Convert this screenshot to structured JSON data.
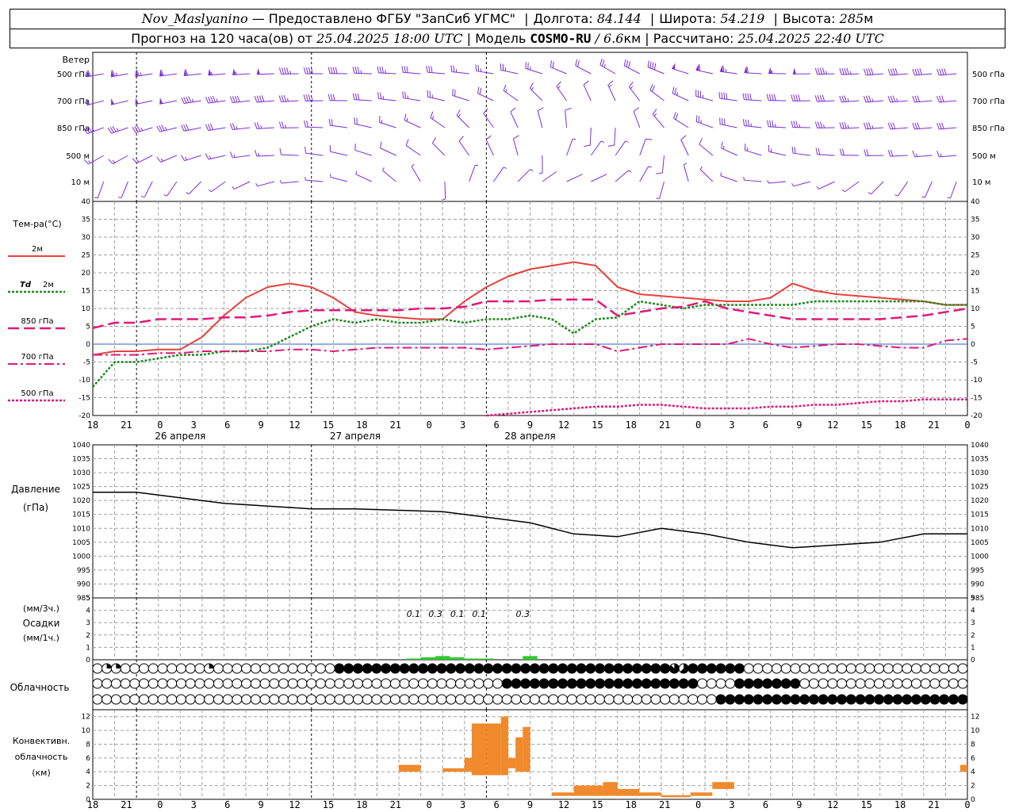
{
  "header": {
    "station": "Nov_Maslyanino",
    "provider": "— Предоставлено ФГБУ \"ЗапСиб УГМС\"",
    "lon_label": "Долгота:",
    "lon_value": "84.144",
    "lat_label": "Широта:",
    "lat_value": "54.219",
    "alt_label": "Высота:",
    "alt_value": "285",
    "alt_unit": "м",
    "forecast_prefix": "Прогноз на 120 часа(ов) от",
    "forecast_start": "25.04.2025 18:00 UTC",
    "model_label": "| Модель",
    "model_name": "COSMO-RU",
    "model_res": "/ 6.6",
    "model_res_unit": "км",
    "calc_label": "| Рассчитано:",
    "calc_time": "25.04.2025 22:40 UTC"
  },
  "colors": {
    "wind": "#7b2ed6",
    "t2m": "#e8413c",
    "td2m": "#1f8a1f",
    "t850": "#e0187a",
    "t700": "#e0187a",
    "t500": "#e0187a",
    "pressure": "#000000",
    "precip": "#32c832",
    "convective": "#f08a2c",
    "grid": "#a0a0a0"
  },
  "time_axis": {
    "ticks": [
      "18",
      "21",
      "0",
      "3",
      "6",
      "9",
      "12",
      "15",
      "18",
      "21",
      "0",
      "3",
      "6",
      "9",
      "12",
      "15",
      "18",
      "21",
      "0",
      "3",
      "6",
      "9",
      "12",
      "15",
      "18",
      "21",
      "0"
    ],
    "day_labels": [
      {
        "label": "26 апреля",
        "at": 12
      },
      {
        "label": "27 апреля",
        "at": 36
      },
      {
        "label": "28 апреля",
        "at": 60
      }
    ],
    "midnights": [
      6,
      30,
      54
    ]
  },
  "wind_panel": {
    "title": "Ветер",
    "levels": [
      "500 гПа",
      "700 гПа",
      "850 гПа",
      "500 м",
      "10 м"
    ],
    "speed_kt": [
      [
        60,
        62,
        64,
        62,
        60,
        58,
        55,
        52,
        48,
        44,
        40,
        36,
        34,
        32,
        30,
        28,
        26,
        26,
        24,
        22,
        20,
        22,
        28,
        36,
        48,
        56,
        62,
        64,
        60,
        55,
        48,
        44,
        42,
        40,
        40,
        40,
        38
      ],
      [
        48,
        50,
        52,
        50,
        48,
        45,
        42,
        40,
        38,
        35,
        32,
        30,
        28,
        26,
        24,
        22,
        20,
        18,
        16,
        14,
        12,
        12,
        14,
        18,
        24,
        30,
        36,
        40,
        42,
        42,
        40,
        38,
        36,
        34,
        32,
        30,
        30
      ],
      [
        32,
        34,
        36,
        35,
        33,
        30,
        28,
        26,
        24,
        22,
        20,
        18,
        18,
        16,
        15,
        14,
        12,
        12,
        10,
        10,
        8,
        8,
        10,
        12,
        16,
        22,
        28,
        32,
        34,
        36,
        36,
        36,
        34,
        32,
        30,
        28,
        28
      ],
      [
        15,
        16,
        16,
        15,
        14,
        14,
        13,
        13,
        12,
        12,
        11,
        11,
        10,
        10,
        9,
        9,
        8,
        8,
        7,
        6,
        6,
        6,
        7,
        8,
        9,
        10,
        12,
        14,
        16,
        18,
        20,
        22,
        22,
        20,
        18,
        16,
        14
      ],
      [
        4,
        4,
        5,
        5,
        6,
        6,
        6,
        5,
        5,
        4,
        4,
        4,
        4,
        3,
        3,
        3,
        3,
        3,
        3,
        2,
        2,
        2,
        3,
        3,
        3,
        4,
        4,
        5,
        5,
        5,
        5,
        5,
        5,
        4,
        4,
        4,
        4
      ]
    ],
    "dir_deg": [
      [
        260,
        260,
        260,
        262,
        262,
        265,
        265,
        268,
        268,
        270,
        270,
        272,
        272,
        274,
        275,
        275,
        278,
        280,
        285,
        290,
        295,
        300,
        300,
        295,
        290,
        285,
        280,
        275,
        272,
        270,
        268,
        268,
        266,
        265,
        265,
        265,
        265
      ],
      [
        255,
        255,
        258,
        258,
        260,
        262,
        262,
        265,
        265,
        268,
        270,
        272,
        275,
        278,
        280,
        285,
        290,
        300,
        310,
        320,
        330,
        340,
        330,
        315,
        300,
        290,
        280,
        275,
        272,
        270,
        268,
        266,
        265,
        265,
        265,
        265,
        265
      ],
      [
        250,
        250,
        252,
        255,
        258,
        260,
        262,
        265,
        268,
        270,
        275,
        280,
        285,
        290,
        300,
        310,
        320,
        330,
        340,
        350,
        360,
        10,
        350,
        330,
        310,
        295,
        285,
        278,
        275,
        272,
        270,
        268,
        266,
        265,
        265,
        265,
        265
      ],
      [
        240,
        240,
        242,
        245,
        250,
        255,
        260,
        265,
        270,
        275,
        280,
        285,
        290,
        300,
        310,
        320,
        330,
        340,
        350,
        10,
        30,
        40,
        30,
        10,
        350,
        320,
        300,
        290,
        285,
        280,
        275,
        272,
        270,
        268,
        266,
        265,
        265
      ],
      [
        200,
        200,
        205,
        210,
        220,
        230,
        240,
        250,
        260,
        270,
        280,
        290,
        300,
        320,
        340,
        10,
        30,
        40,
        50,
        60,
        70,
        60,
        40,
        20,
        360,
        330,
        300,
        280,
        270,
        260,
        250,
        240,
        230,
        220,
        210,
        200,
        200
      ]
    ]
  },
  "temp_panel": {
    "title": "Тем-ра(°C)",
    "legend": [
      {
        "key": "t2m",
        "label": "2м"
      },
      {
        "key": "td2m",
        "label_a": "Td",
        "label_b": "2м"
      },
      {
        "key": "t850",
        "label": "850 гПа"
      },
      {
        "key": "t700",
        "label": "700 гПа"
      },
      {
        "key": "t500",
        "label": "500 гПа"
      }
    ],
    "ylim": [
      -20,
      40
    ],
    "yticks": [
      -20,
      -15,
      -10,
      -5,
      0,
      5,
      10,
      15,
      20,
      25,
      30,
      35,
      40
    ]
  },
  "pressure_panel": {
    "title": "Давление",
    "unit": "(гПа)",
    "ylim": [
      985,
      1040
    ],
    "yticks": [
      985,
      990,
      995,
      1000,
      1005,
      1010,
      1015,
      1020,
      1025,
      1030,
      1035,
      1040
    ]
  },
  "precip_panel": {
    "unit_top": "(мм/3ч.)",
    "title": "Осадки",
    "unit_bottom": "(мм/1ч.)",
    "ylim": [
      0,
      5
    ],
    "yticks": [
      0,
      1,
      2,
      3,
      4,
      5
    ],
    "labels": [
      {
        "text": "0.1",
        "at": 44
      },
      {
        "text": "0.3",
        "at": 47
      },
      {
        "text": "0.1",
        "at": 50
      },
      {
        "text": "0.1",
        "at": 53
      },
      {
        "text": "0.3",
        "at": 59
      }
    ]
  },
  "cloud_panel": {
    "title": "Облачность",
    "rows": [
      "0220000000002000000000000088888888888888888888888888888888888875888888000000000000000000000000",
      "0000000000000000000000000000000000000000000088888888888888888888800008888888000000000000000000",
      "0000000000000000000000000000000000000000000000000000000000000000000888888888888888888888888888"
    ]
  },
  "conv_panel": {
    "title_a": "Конвективн.",
    "title_b": "облачность",
    "unit": "(км)",
    "ylim": [
      0,
      13
    ],
    "yticks": [
      0,
      2,
      4,
      6,
      8,
      10,
      12
    ]
  },
  "chart_data": [
    {
      "type": "line",
      "title": "Тем-ра(°C)",
      "ylim": [
        -20,
        40
      ],
      "x": [
        0,
        3,
        6,
        9,
        12,
        15,
        18,
        21,
        24,
        27,
        30,
        33,
        36,
        39,
        42,
        45,
        48,
        51,
        54,
        57,
        60,
        63,
        66,
        69,
        72,
        75,
        78,
        81,
        84,
        87,
        90,
        93,
        96,
        99,
        102,
        105,
        108,
        111,
        114,
        117,
        120
      ],
      "series": [
        {
          "name": "2м",
          "values": [
            -3,
            -2,
            -2,
            -1.5,
            -1.5,
            2,
            8,
            13,
            16,
            17,
            16,
            13,
            9,
            8,
            7.5,
            7,
            7,
            12,
            16,
            19,
            21,
            22,
            23,
            22,
            16,
            14,
            13.5,
            13,
            12.5,
            12,
            12,
            13,
            17,
            15,
            14,
            13.5,
            13,
            12.5,
            12,
            11,
            11
          ]
        },
        {
          "name": "Td 2м",
          "values": [
            -12,
            -5,
            -5,
            -4,
            -3,
            -3,
            -2,
            -2,
            -1,
            2,
            5,
            7,
            6,
            7,
            6,
            6,
            7,
            6,
            7,
            7,
            8,
            7,
            3,
            7,
            7.5,
            12,
            11,
            10,
            11,
            11,
            11,
            11,
            11,
            12,
            12,
            12,
            12,
            12,
            12,
            11,
            11
          ]
        },
        {
          "name": "850 гПа",
          "values": [
            4.5,
            6,
            6,
            7,
            7,
            7,
            7.5,
            7.5,
            8,
            9,
            9.5,
            9.5,
            9.5,
            9.5,
            9.5,
            10,
            10,
            10.5,
            12,
            12,
            12,
            12.5,
            12.5,
            12.5,
            8,
            9,
            10,
            10.5,
            12,
            10,
            9,
            8,
            7,
            7,
            7,
            7,
            7,
            7.5,
            8,
            9,
            10
          ]
        },
        {
          "name": "700 гПа",
          "values": [
            -3,
            -3,
            -3,
            -2.5,
            -2.5,
            -2,
            -2,
            -2,
            -2,
            -1.5,
            -1.5,
            -2,
            -1.5,
            -1,
            -1,
            -1,
            -1,
            -1,
            -1.5,
            -1,
            -0.5,
            0,
            0,
            0,
            -2,
            -1,
            0,
            0,
            0,
            0,
            1.5,
            0,
            -1,
            -0.5,
            0,
            0,
            -0.5,
            -1,
            -1,
            1,
            1.5
          ]
        },
        {
          "name": "500 гПа",
          "values": [
            null,
            null,
            null,
            null,
            null,
            null,
            null,
            null,
            null,
            null,
            null,
            null,
            null,
            null,
            null,
            null,
            null,
            null,
            -20,
            -19.5,
            -19,
            -18.5,
            -18,
            -17.5,
            -17.5,
            -17,
            -17,
            -17.5,
            -18,
            -18,
            -18,
            -17.5,
            -17.5,
            -17,
            -17,
            -16.5,
            -16,
            -16,
            -15.5,
            -15.5,
            -15.5
          ]
        }
      ]
    },
    {
      "type": "line",
      "title": "Давление",
      "ylim": [
        985,
        1040
      ],
      "x": [
        0,
        6,
        12,
        18,
        24,
        30,
        36,
        42,
        48,
        54,
        60,
        66,
        72,
        78,
        84,
        90,
        96,
        102,
        108,
        114,
        120
      ],
      "series": [
        {
          "name": "Давление",
          "values": [
            1023,
            1023,
            1021,
            1019,
            1018,
            1017,
            1017,
            1016.5,
            1016,
            1014,
            1012,
            1008,
            1007,
            1010,
            1008,
            1005,
            1003,
            1004,
            1005,
            1008,
            1008
          ]
        }
      ]
    },
    {
      "type": "bar",
      "title": "Осадки",
      "ylim": [
        0,
        5
      ],
      "x": [
        43,
        45,
        47,
        49,
        51,
        53,
        59
      ],
      "values": [
        0.1,
        0.2,
        0.3,
        0.2,
        0.1,
        0.1,
        0.3
      ]
    },
    {
      "type": "bar",
      "title": "Конвективн. облачность",
      "ylim": [
        0,
        13
      ],
      "segments": [
        {
          "t0": 42,
          "t1": 45,
          "base": 4,
          "top": 5
        },
        {
          "t0": 48,
          "t1": 51,
          "base": 4,
          "top": 4.5
        },
        {
          "t0": 51,
          "t1": 52,
          "base": 4,
          "top": 6
        },
        {
          "t0": 52,
          "t1": 54,
          "base": 3.5,
          "top": 11
        },
        {
          "t0": 54,
          "t1": 56,
          "base": 3.5,
          "top": 11
        },
        {
          "t0": 56,
          "t1": 57,
          "base": 3.5,
          "top": 12
        },
        {
          "t0": 57,
          "t1": 58,
          "base": 4.5,
          "top": 6
        },
        {
          "t0": 58,
          "t1": 59,
          "base": 4,
          "top": 9
        },
        {
          "t0": 59,
          "t1": 60,
          "base": 4,
          "top": 10.5
        },
        {
          "t0": 63,
          "t1": 66,
          "base": 0.5,
          "top": 1
        },
        {
          "t0": 66,
          "t1": 70,
          "base": 0.5,
          "top": 2
        },
        {
          "t0": 70,
          "t1": 72,
          "base": 0.5,
          "top": 2.5
        },
        {
          "t0": 72,
          "t1": 75,
          "base": 0.5,
          "top": 1.5
        },
        {
          "t0": 75,
          "t1": 78,
          "base": 0.5,
          "top": 1
        },
        {
          "t0": 78,
          "t1": 82,
          "base": 0.3,
          "top": 0.6
        },
        {
          "t0": 82,
          "t1": 85,
          "base": 0.5,
          "top": 1
        },
        {
          "t0": 85,
          "t1": 88,
          "base": 1.5,
          "top": 2.5
        },
        {
          "t0": 119,
          "t1": 120,
          "base": 4,
          "top": 5
        }
      ]
    }
  ]
}
